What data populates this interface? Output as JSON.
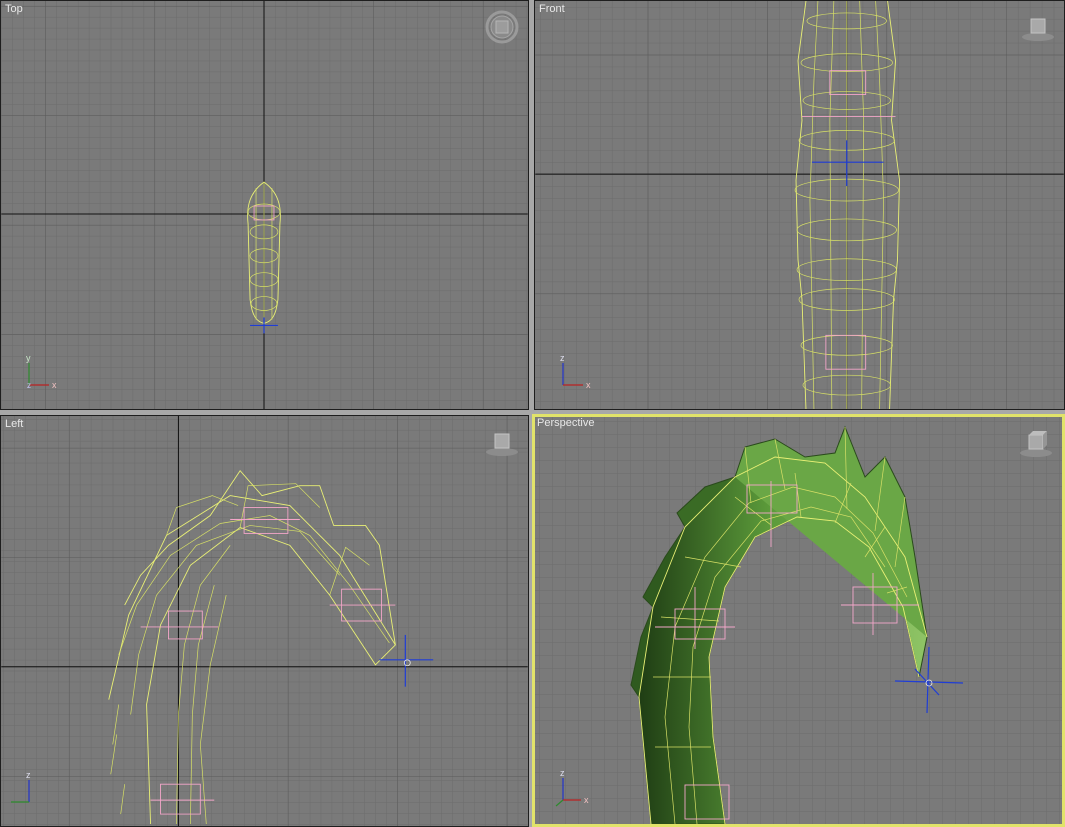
{
  "viewports": {
    "top": {
      "label": "Top",
      "axis_h": "x",
      "axis_v": "y"
    },
    "front": {
      "label": "Front",
      "axis_h": "x",
      "axis_v": "z"
    },
    "left": {
      "label": "Left",
      "axis_h": "",
      "axis_v": "z"
    },
    "perspective": {
      "label": "Perspective",
      "axis_h": "x",
      "axis_v": "z",
      "active": true
    }
  },
  "colors": {
    "viewport_bg": "#7a7a7a",
    "grid_minor": "#6e6e6e",
    "grid_major": "#5a5a5a",
    "wireframe": "#e9f075",
    "bone": "#f3a6c9",
    "pivot": "#1f3dd6",
    "active_border": "#e1e36a",
    "shaded_mesh": "#4f8a34"
  },
  "icons": {
    "viewcube": "viewcube-icon",
    "steering_wheel": "steering-wheel-icon",
    "axis_tripod": "axis-tripod-icon"
  }
}
